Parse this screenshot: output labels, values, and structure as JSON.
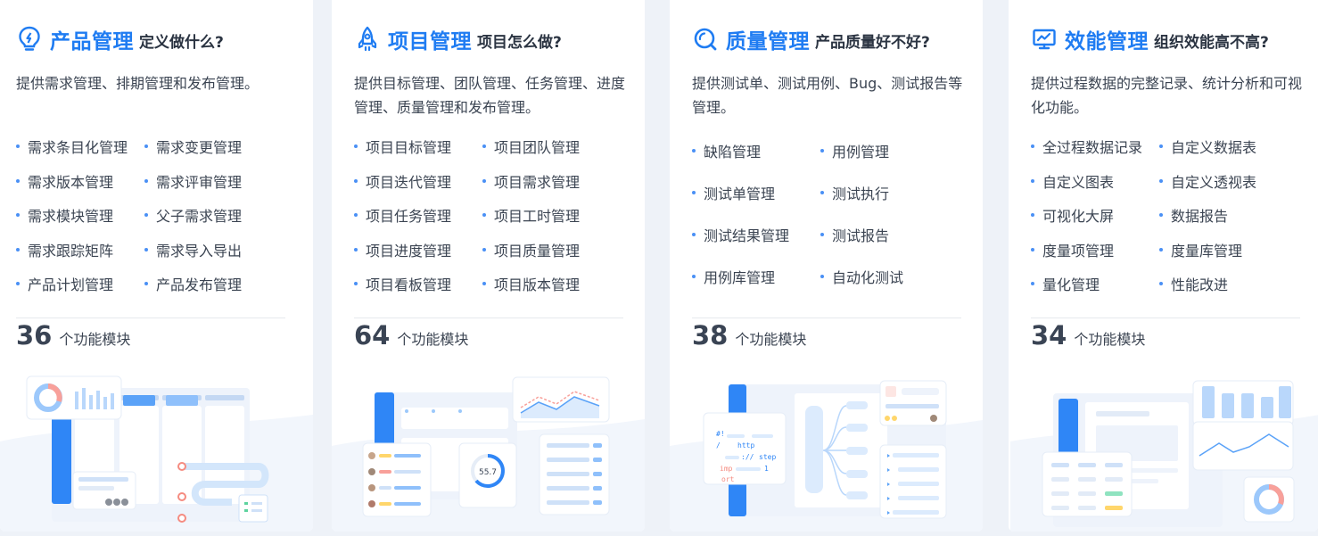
{
  "cards": [
    {
      "title": "产品管理",
      "subtitle": "定义做什么?",
      "icon": "lightbulb-icon",
      "description": "提供需求管理、排期管理和发布管理。",
      "features": [
        "需求条目化管理",
        "需求变更管理",
        "需求版本管理",
        "需求评审管理",
        "需求模块管理",
        "父子需求管理",
        "需求跟踪矩阵",
        "需求导入导出",
        "产品计划管理",
        "产品发布管理"
      ],
      "count": "36",
      "count_unit": "个功能模块"
    },
    {
      "title": "项目管理",
      "subtitle": "项目怎么做?",
      "icon": "rocket-icon",
      "description": "提供目标管理、团队管理、任务管理、进度管理、质量管理和发布管理。",
      "features": [
        "项目目标管理",
        "项目团队管理",
        "项目迭代管理",
        "项目需求管理",
        "项目任务管理",
        "项目工时管理",
        "项目进度管理",
        "项目质量管理",
        "项目看板管理",
        "项目版本管理"
      ],
      "count": "64",
      "count_unit": "个功能模块",
      "illustration_label": "55.7"
    },
    {
      "title": "质量管理",
      "subtitle": "产品质量好不好?",
      "icon": "search-q-icon",
      "description": "提供测试单、测试用例、Bug、测试报告等管理。",
      "features": [
        "缺陷管理",
        "用例管理",
        "测试单管理",
        "测试执行",
        "测试结果管理",
        "测试报告",
        "用例库管理",
        "自动化测试"
      ],
      "count": "38",
      "count_unit": "个功能模块",
      "code_lines": [
        "#!",
        "/",
        "http",
        "://",
        "step",
        "imp",
        "1",
        "ort"
      ]
    },
    {
      "title": "效能管理",
      "subtitle": "组织效能高不高?",
      "icon": "monitor-chart-icon",
      "description": "提供过程数据的完整记录、统计分析和可视化功能。",
      "features": [
        "全过程数据记录",
        "自定义数据表",
        "自定义图表",
        "自定义透视表",
        "可视化大屏",
        "数据报告",
        "度量项管理",
        "度量库管理",
        "量化管理",
        "性能改进"
      ],
      "count": "34",
      "count_unit": "个功能模块"
    }
  ],
  "colors": {
    "accent": "#1f7cf2",
    "bullet": "#4a90f5",
    "background": "#eef2f8",
    "card": "#ffffff"
  }
}
